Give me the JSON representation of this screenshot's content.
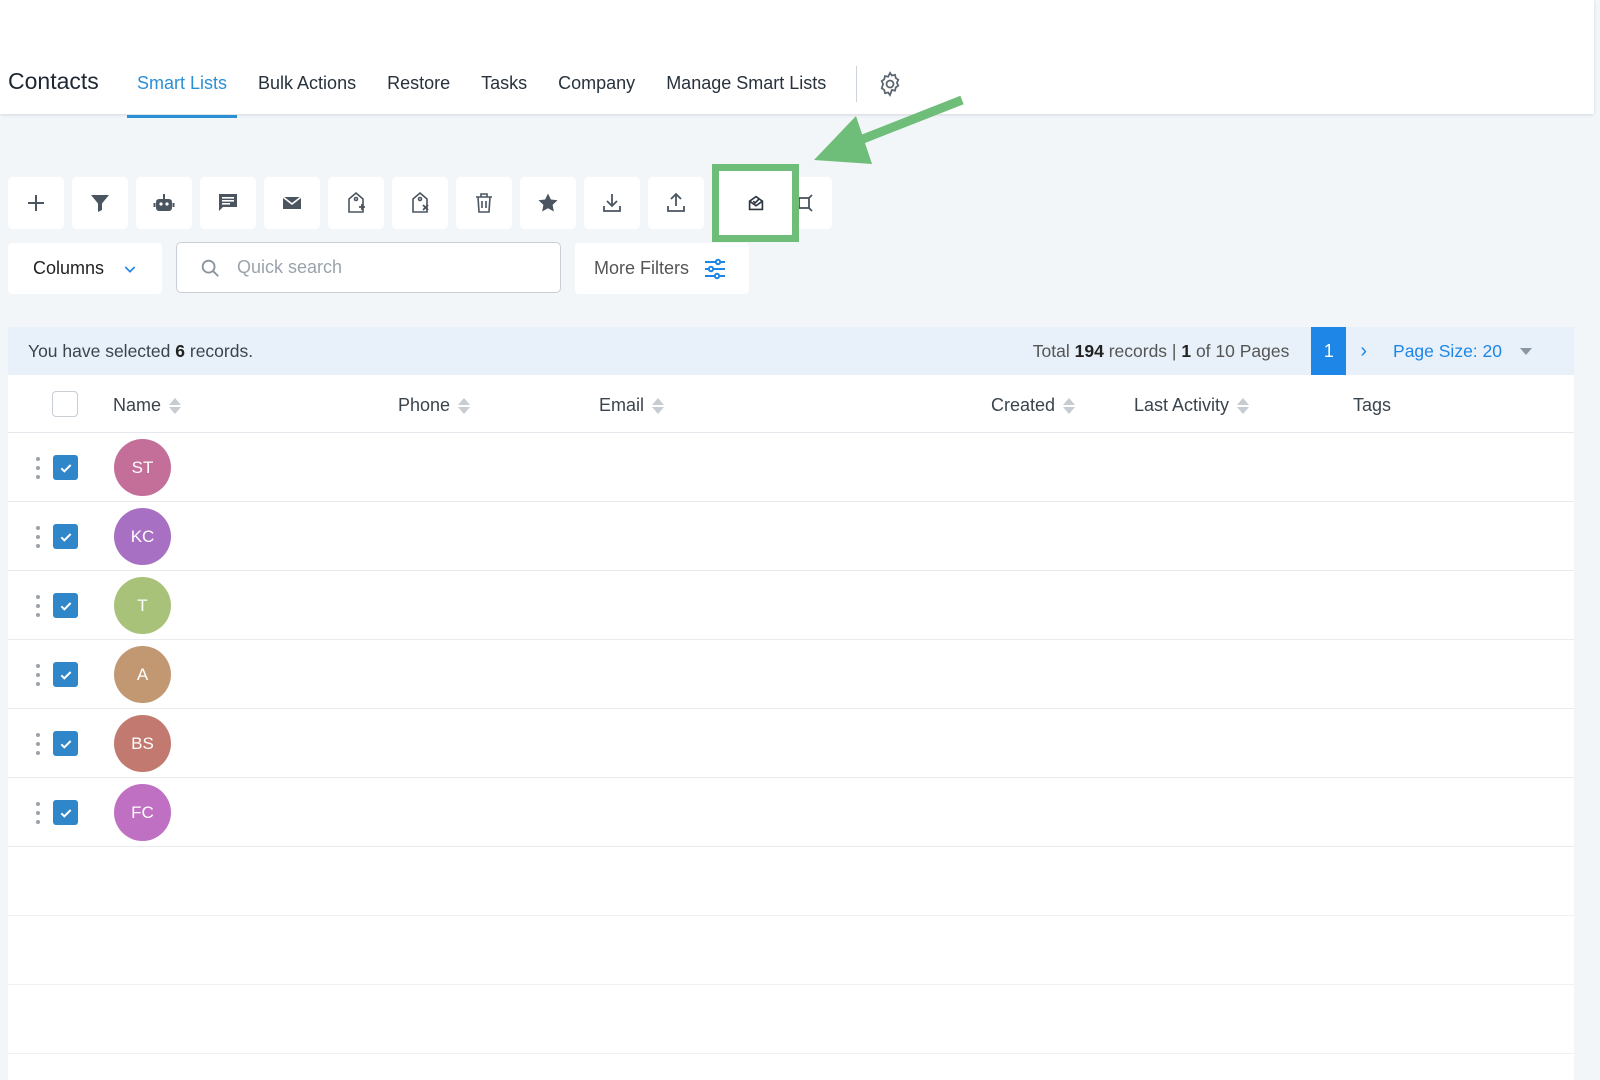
{
  "header": {
    "title": "Contacts",
    "nav": [
      "Smart Lists",
      "Bulk Actions",
      "Restore",
      "Tasks",
      "Company",
      "Manage Smart Lists"
    ],
    "active_nav": "Smart Lists"
  },
  "toolbar": {
    "icons": [
      "plus-icon",
      "filter-icon",
      "robot-icon",
      "message-icon",
      "email-icon",
      "tag-add-icon",
      "tag-remove-icon",
      "trash-icon",
      "star-icon",
      "download-icon",
      "upload-icon",
      "review-request-icon",
      "merge-icon"
    ]
  },
  "annotation": {
    "highlight_color": "#6ebd78"
  },
  "filters": {
    "columns_label": "Columns",
    "search_placeholder": "Quick search",
    "more_filters_label": "More Filters"
  },
  "selection": {
    "prefix": "You have selected",
    "count": "6",
    "suffix": "records."
  },
  "pagination": {
    "total_prefix": "Total",
    "total_records": "194",
    "records_sep": "records |",
    "current_page": "1",
    "of_pages": "of 10 Pages",
    "page_button": "1",
    "next": "›",
    "page_size": "Page Size: 20"
  },
  "table": {
    "columns": [
      "Name",
      "Phone",
      "Email",
      "Created",
      "Last Activity",
      "Tags"
    ],
    "rows": [
      {
        "initials": "ST",
        "color": "#c46f9a",
        "checked": true
      },
      {
        "initials": "KC",
        "color": "#a770c2",
        "checked": true
      },
      {
        "initials": "T",
        "color": "#a9c27a",
        "checked": true
      },
      {
        "initials": "A",
        "color": "#c29872",
        "checked": true
      },
      {
        "initials": "BS",
        "color": "#c27a70",
        "checked": true
      },
      {
        "initials": "FC",
        "color": "#c070c2",
        "checked": true
      }
    ]
  },
  "colors": {
    "accent": "#2b8fd6",
    "primary_button": "#1e86e6",
    "checkbox": "#2f86c8"
  }
}
